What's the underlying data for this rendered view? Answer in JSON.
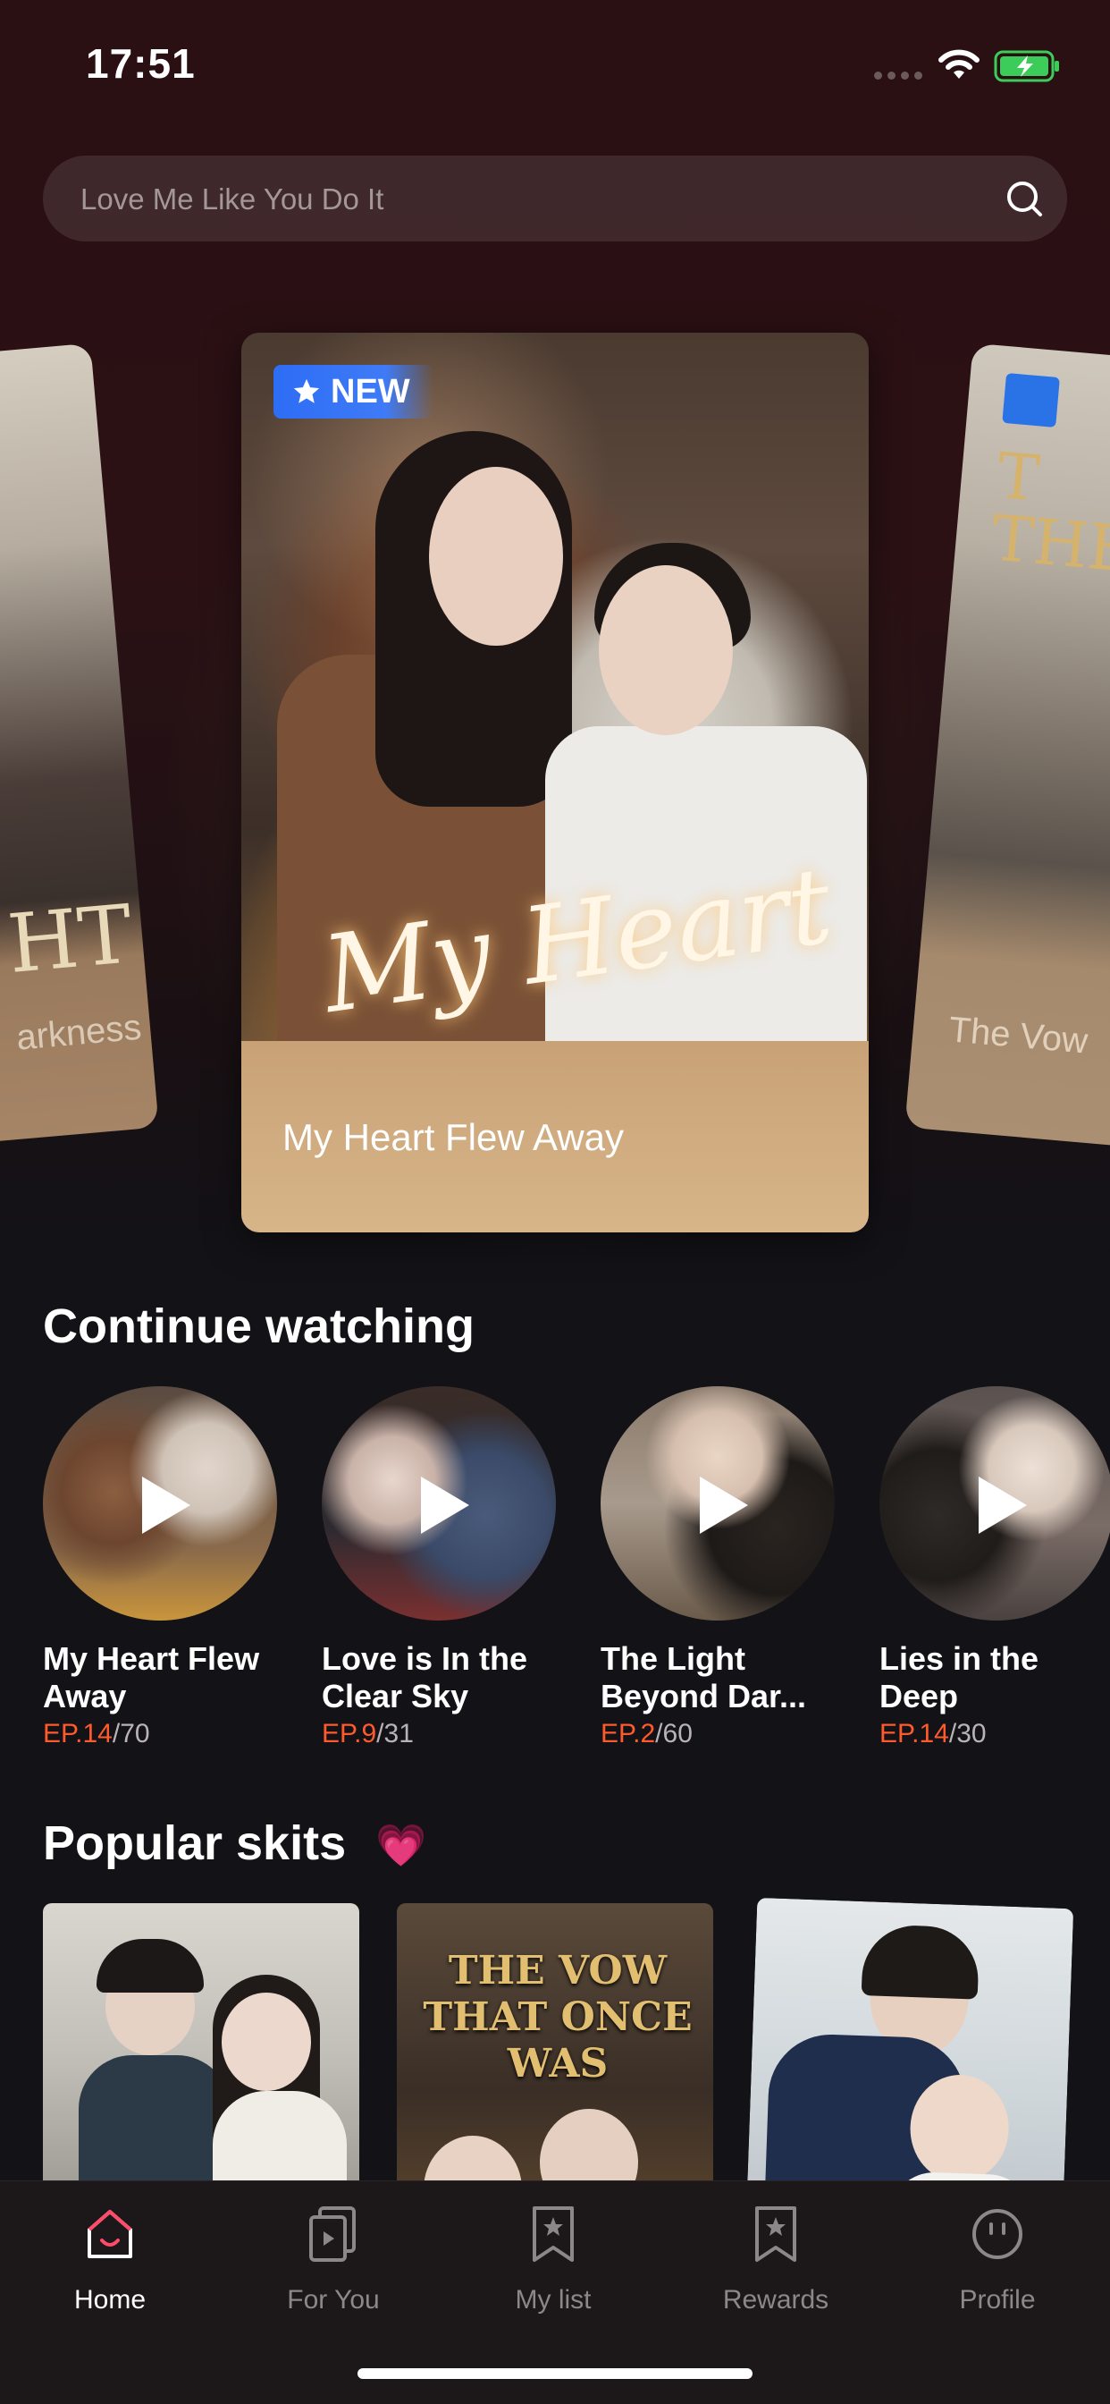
{
  "status": {
    "time": "17:51"
  },
  "search": {
    "placeholder": "Love Me Like You Do It"
  },
  "carousel": {
    "left_card_caption": "arkness",
    "left_card_title": "HT",
    "hero": {
      "badge": "NEW",
      "caption": "My Heart Flew Away",
      "logo_text": "My Heart"
    },
    "right_card_caption": "The Vow",
    "right_card_title": "T\nTHE"
  },
  "continue_watching": {
    "title": "Continue watching",
    "items": [
      {
        "name": "My Heart Flew Away",
        "ep_current": "EP.14",
        "ep_total": "/70"
      },
      {
        "name": "Love is In the Clear Sky",
        "ep_current": "EP.9",
        "ep_total": "/31"
      },
      {
        "name": "The Light Beyond Dar...",
        "ep_current": "EP.2",
        "ep_total": "/60"
      },
      {
        "name": "Lies in the Deep",
        "ep_current": "EP.14",
        "ep_total": "/30"
      }
    ]
  },
  "popular": {
    "title": "Popular skits",
    "emoji": "💗",
    "cards": [
      {
        "title_text": ""
      },
      {
        "title_text": "THE VOW THAT ONCE WAS"
      },
      {
        "title_text": ""
      }
    ]
  },
  "tabbar": {
    "items": [
      {
        "label": "Home",
        "icon": "home-icon"
      },
      {
        "label": "For You",
        "icon": "play-stack-icon"
      },
      {
        "label": "My list",
        "icon": "bookmark-star-icon"
      },
      {
        "label": "Rewards",
        "icon": "bookmark-star-icon"
      },
      {
        "label": "Profile",
        "icon": "smiley-icon"
      }
    ]
  },
  "colors": {
    "accent": "#ff5a2c",
    "badge_blue": "#2d6df5",
    "background": "#121217"
  }
}
